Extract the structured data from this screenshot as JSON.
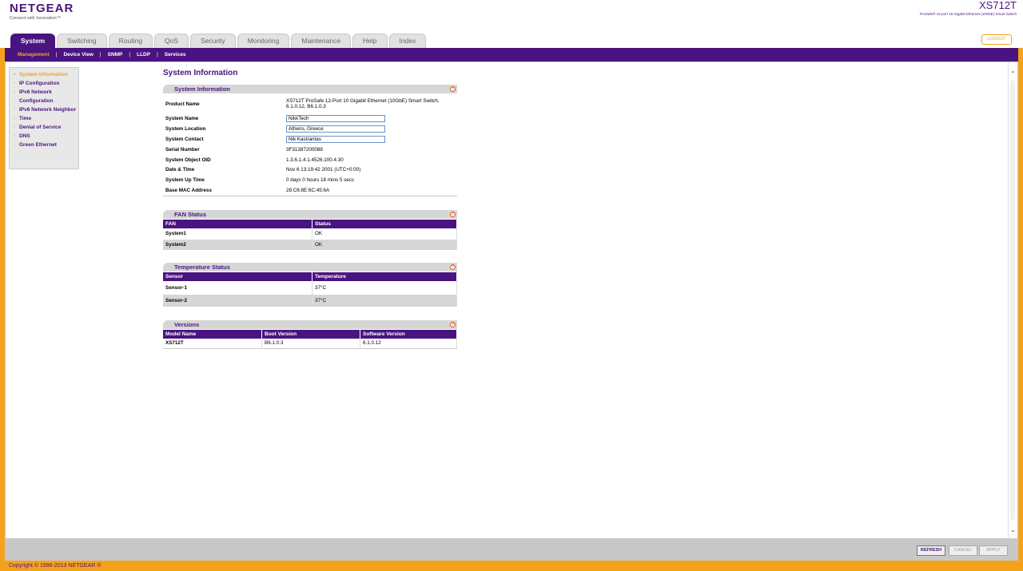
{
  "brand": {
    "logo": "NETGEAR",
    "tagline": "Connect with Innovation™"
  },
  "device": {
    "model": "XS712T",
    "description": "ProSafe® 12-port 10 Gigabit Ethernet (10GbE) Smart Switch"
  },
  "logout_label": "LOGOUT",
  "tabs": [
    "System",
    "Switching",
    "Routing",
    "QoS",
    "Security",
    "Monitoring",
    "Maintenance",
    "Help",
    "Index"
  ],
  "subnav": [
    "Management",
    "Device View",
    "SNMP",
    "LLDP",
    "Services"
  ],
  "left_menu": [
    "System Information",
    "IP Configuration",
    "IPv6 Network Configuration",
    "IPv6 Network Neighbor",
    "Time",
    "Denial of Service",
    "DNS",
    "Green Ethernet"
  ],
  "page_title": "System Information",
  "system_info": {
    "title": "System Information",
    "product_name_label": "Product Name",
    "product_name": "XS712T ProSafe 12-Port 10 Gigabit Ethernet (10GbE) Smart Switch, 6.1.0.12, B6.1.0.3",
    "system_name_label": "System Name",
    "system_name": "NikkTech",
    "system_location_label": "System Location",
    "system_location": "Athens, Greece",
    "system_contact_label": "System Contact",
    "system_contact": "Nik Kastrantas",
    "serial_label": "Serial Number",
    "serial": "3F31387200088",
    "oid_label": "System Object OID",
    "oid": "1.3.6.1.4.1.4526.100.4.30",
    "datetime_label": "Date & Time",
    "datetime": "Nov 6 13:19:42 2001 (UTC+0:00)",
    "uptime_label": "System Up Time",
    "uptime": "0 days 0 hours 18 mins 5 secs",
    "mac_label": "Base MAC Address",
    "mac": "28:C6:8E:6C:45:6A"
  },
  "fan_status": {
    "title": "FAN Status",
    "col_fan": "FAN",
    "col_status": "Status",
    "rows": [
      {
        "name": "System1",
        "status": "OK"
      },
      {
        "name": "System2",
        "status": "OK"
      }
    ]
  },
  "temperature_status": {
    "title": "Temperature Status",
    "col_sensor": "Sensor",
    "col_temp": "Temperature",
    "rows": [
      {
        "name": "Sensor-1",
        "temp": "37°C"
      },
      {
        "name": "Sensor-2",
        "temp": "37°C"
      }
    ]
  },
  "versions": {
    "title": "Versions",
    "col_model": "Model Name",
    "col_boot": "Boot Version",
    "col_software": "Software Version",
    "model": "XS712T",
    "boot": "B6.1.0.3",
    "software": "6.1.0.12"
  },
  "buttons": {
    "refresh": "REFRESH",
    "cancel": "CANCEL",
    "apply": "APPLY"
  },
  "copyright": "Copyright © 1996-2013 NETGEAR ®",
  "help_glyph": "?",
  "colors": {
    "brand_purple": "#4a1480",
    "accent_orange": "#f5a21b"
  }
}
